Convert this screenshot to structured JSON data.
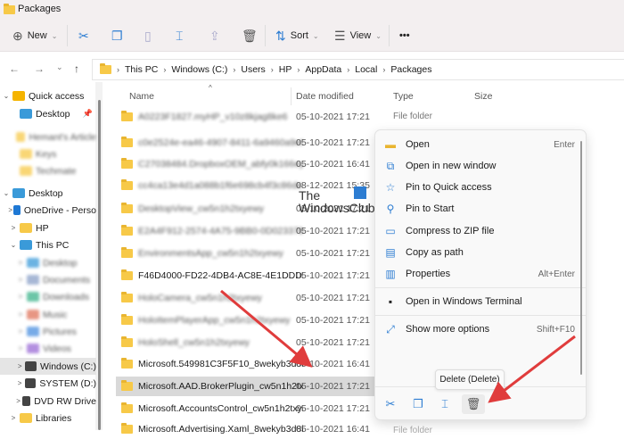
{
  "window": {
    "title": "Packages"
  },
  "toolbar": {
    "new_label": "New",
    "sort_label": "Sort",
    "view_label": "View",
    "more_label": "•••"
  },
  "address": {
    "crumbs": [
      "This PC",
      "Windows (C:)",
      "Users",
      "HP",
      "AppData",
      "Local",
      "Packages"
    ]
  },
  "sidebar": {
    "items": [
      {
        "label": "Quick access",
        "icon": "star-icon",
        "color": "#f5b400"
      },
      {
        "label": "Desktop",
        "icon": "desktop-icon",
        "color": "#3a9ad9"
      },
      {
        "label": "Hemant's Article",
        "icon": "folder-icon",
        "color": "#f7c948"
      },
      {
        "label": "Keys",
        "icon": "folder-icon",
        "color": "#f7c948"
      },
      {
        "label": "Techmate",
        "icon": "folder-icon",
        "color": "#f7c948"
      },
      {
        "label": "Desktop",
        "icon": "desktop-icon",
        "color": "#3a9ad9"
      },
      {
        "label": "OneDrive - Perso",
        "icon": "cloud-icon",
        "color": "#1e78d4"
      },
      {
        "label": "HP",
        "icon": "folder-icon",
        "color": "#f7c948"
      },
      {
        "label": "This PC",
        "icon": "computer-icon",
        "color": "#3a9ad9"
      },
      {
        "label": "Desktop",
        "icon": "desktop-icon",
        "color": "#3a9ad9"
      },
      {
        "label": "Documents",
        "icon": "documents-icon",
        "color": "#8aa0c8"
      },
      {
        "label": "Downloads",
        "icon": "downloads-icon",
        "color": "#3bb38a"
      },
      {
        "label": "Music",
        "icon": "music-icon",
        "color": "#e0735a"
      },
      {
        "label": "Pictures",
        "icon": "pictures-icon",
        "color": "#4a8fe0"
      },
      {
        "label": "Videos",
        "icon": "videos-icon",
        "color": "#9a6ad6"
      },
      {
        "label": "Windows (C:)",
        "icon": "drive-icon",
        "color": "#444444"
      },
      {
        "label": "SYSTEM (D:)",
        "icon": "drive-icon",
        "color": "#444444"
      },
      {
        "label": "DVD RW Drive",
        "icon": "dvd-icon",
        "color": "#444444"
      },
      {
        "label": "Libraries",
        "icon": "folder-icon",
        "color": "#f7c948"
      }
    ]
  },
  "columns": {
    "name": "Name",
    "date": "Date modified",
    "type": "Type",
    "size": "Size"
  },
  "files": [
    {
      "name": "A0223F1827.myHP_v10z8kjag8ke6",
      "date": "05-10-2021 17:21",
      "type": "File folder"
    },
    {
      "name": "c0e2524e-ea46-4907-8411-6a9460a9e051...",
      "date": "05-10-2021 17:21"
    },
    {
      "name": "C27038484.DropboxOEM_abfy0k166ey96",
      "date": "05-10-2021 16:41"
    },
    {
      "name": "cc4ca13e4d1a088b1f6e698cb4f3c86de73...",
      "date": "08-12-2021 15:35"
    },
    {
      "name": "DesktopView_cw5n1h2txyewy",
      "date": "05-10-2021 17:21"
    },
    {
      "name": "E2A4F912-2574-4A75-9BB0-0D023378359...",
      "date": "05-10-2021 17:21"
    },
    {
      "name": "EnvironmentsApp_cw5n1h2txyewy",
      "date": "05-10-2021 17:21"
    },
    {
      "name": "F46D4000-FD22-4DB4-AC8E-4E1DDDE8...",
      "date": "05-10-2021 17:21"
    },
    {
      "name": "HoloCamera_cw5n1h2txyewy",
      "date": "05-10-2021 17:21"
    },
    {
      "name": "HoloItemPlayerApp_cw5n1h2txyewy",
      "date": "05-10-2021 17:21"
    },
    {
      "name": "HoloShell_cw5n1h2txyewy",
      "date": "05-10-2021 17:21"
    },
    {
      "name": "Microsoft.549981C3F5F10_8wekyb3d8bb...",
      "date": "05-10-2021 16:41"
    },
    {
      "name": "Microsoft.AAD.BrokerPlugin_cw5n1h2txy...",
      "date": "05-10-2021 17:21"
    },
    {
      "name": "Microsoft.AccountsControl_cw5n1h2txye...",
      "date": "05-10-2021 17:21"
    },
    {
      "name": "Microsoft.Advertising.Xaml_8wekyb3d8b...",
      "date": "05-10-2021 16:41",
      "type": "File folder"
    }
  ],
  "context_menu": {
    "items": [
      {
        "label": "Open",
        "shortcut": "Enter",
        "icon": "folder-open-icon"
      },
      {
        "label": "Open in new window",
        "shortcut": "",
        "icon": "new-window-icon"
      },
      {
        "label": "Pin to Quick access",
        "shortcut": "",
        "icon": "star-icon"
      },
      {
        "label": "Pin to Start",
        "shortcut": "",
        "icon": "pin-icon"
      },
      {
        "label": "Compress to ZIP file",
        "shortcut": "",
        "icon": "zip-icon"
      },
      {
        "label": "Copy as path",
        "shortcut": "",
        "icon": "copy-path-icon"
      },
      {
        "label": "Properties",
        "shortcut": "Alt+Enter",
        "icon": "properties-icon"
      },
      {
        "label": "Open in Windows Terminal",
        "shortcut": "",
        "icon": "terminal-icon"
      },
      {
        "label": "Show more options",
        "shortcut": "Shift+F10",
        "icon": "more-options-icon"
      }
    ],
    "tooltip": "Delete (Delete)"
  },
  "watermark": {
    "line1": "The",
    "line2": "WindowsClub"
  },
  "colors": {
    "accent": "#2d7dd2",
    "arrow": "#e03c3c",
    "selection": "#d9d9d9"
  }
}
